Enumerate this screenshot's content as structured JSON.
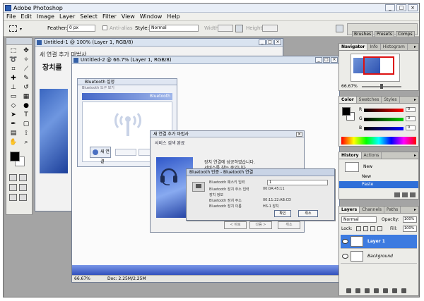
{
  "app": {
    "title": "Adobe Photoshop",
    "window_buttons": [
      "_",
      "□",
      "×"
    ]
  },
  "menu": [
    "File",
    "Edit",
    "Image",
    "Layer",
    "Select",
    "Filter",
    "View",
    "Window",
    "Help"
  ],
  "options": {
    "feather_label": "Feather:",
    "feather_value": "0 px",
    "antialias_label": "Anti-alias",
    "style_label": "Style:",
    "style_value": "Normal",
    "width_label": "Width:",
    "height_label": "Height:",
    "well_tabs": [
      "Brushes",
      "Presets",
      "Comps"
    ]
  },
  "documents": {
    "doc1_title": "Untitled-1 @ 100% (Layer 1, RGB/8)",
    "doc1_text": "새 연결 추가 마법사",
    "doc1_heading": "장치를",
    "doc2_title": "Untitled-2 @ 66.7% (Layer 1, RGB/8)",
    "doc2_zoom": "66.67%",
    "doc2_docsize": "Doc: 2.25M/2.25M"
  },
  "bluetooth": {
    "title": "Bluetooth 설정",
    "tabs_text": "Bluetooth  도구  보기",
    "header": "Bluetooth",
    "new_conn_label": "새 연결",
    "gray_buttons": [
      "",
      "",
      ""
    ]
  },
  "wizard": {
    "title": "새 연결 추가 마법사",
    "heading": "서비스 검색 완료",
    "text_line1": "장치 연결에 성공하였습니다.",
    "text_line2": "서비스를 찾는 중입니다.",
    "buttons": [
      "< 뒤로",
      "다음 >",
      "취소"
    ]
  },
  "auth": {
    "title": "Bluetooth 인증 - Bluetooth 연결",
    "label1": "Bluetooth 패스키 입력",
    "label2": "Bluetooth 장치 주소 입력",
    "value2": "00:0A:45:11",
    "label3": "장치 정보",
    "label4": "Bluetooth 장치 주소",
    "value4": "00:11:22:AB:CD",
    "label5": "Bluetooth 장치 이름",
    "value5": "HS-1 장치",
    "passkey_value": "1",
    "ok_button": "확인",
    "cancel_button": "취소"
  },
  "navigator": {
    "tabs": [
      "Navigator",
      "Info",
      "Histogram"
    ],
    "zoom": "66.67%"
  },
  "color": {
    "tabs": [
      "Color",
      "Swatches",
      "Styles"
    ],
    "channels": [
      {
        "label": "R",
        "value": "0"
      },
      {
        "label": "G",
        "value": "0"
      },
      {
        "label": "B",
        "value": "0"
      }
    ]
  },
  "history": {
    "tabs": [
      "History",
      "Actions"
    ],
    "snapshot_label": "New",
    "items": [
      "New",
      "Paste"
    ]
  },
  "layers": {
    "tabs": [
      "Layers",
      "Channels",
      "Paths"
    ],
    "blend_mode": "Normal",
    "opacity_label": "Opacity:",
    "opacity_value": "100%",
    "lock_label": "Lock:",
    "fill_label": "Fill:",
    "fill_value": "100%",
    "items": [
      {
        "name": "Layer 1",
        "selected": true
      },
      {
        "name": "Background",
        "selected": false
      }
    ]
  },
  "colors": {
    "accent_selected": "#2f6fd8",
    "panel_bg": "#ecece8",
    "workspace": "#a4a4a4"
  }
}
